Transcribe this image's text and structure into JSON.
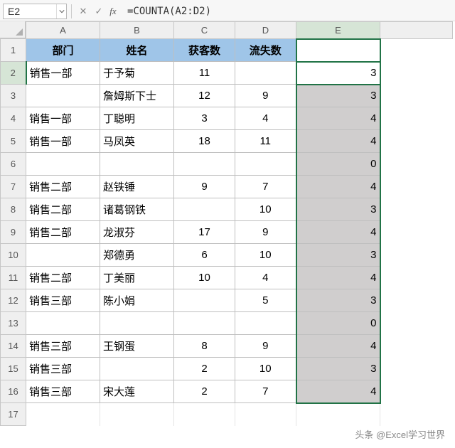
{
  "name_box": "E2",
  "formula": "=COUNTA(A2:D2)",
  "columns": [
    "A",
    "B",
    "C",
    "D",
    "E"
  ],
  "header_row": {
    "A": "部门",
    "B": "姓名",
    "C": "获客数",
    "D": "流失数",
    "E": ""
  },
  "rows": [
    {
      "n": 2,
      "A": "销售一部",
      "B": "于予菊",
      "C": "11",
      "D": "",
      "E": "3"
    },
    {
      "n": 3,
      "A": "",
      "B": "詹姆斯下士",
      "C": "12",
      "D": "9",
      "E": "3"
    },
    {
      "n": 4,
      "A": "销售一部",
      "B": "丁聪明",
      "C": "3",
      "D": "4",
      "E": "4"
    },
    {
      "n": 5,
      "A": "销售一部",
      "B": "马凤英",
      "C": "18",
      "D": "11",
      "E": "4"
    },
    {
      "n": 6,
      "A": "",
      "B": "",
      "C": "",
      "D": "",
      "E": "0"
    },
    {
      "n": 7,
      "A": "销售二部",
      "B": "赵铁锤",
      "C": "9",
      "D": "7",
      "E": "4"
    },
    {
      "n": 8,
      "A": "销售二部",
      "B": "诸葛钢铁",
      "C": "",
      "D": "10",
      "E": "3"
    },
    {
      "n": 9,
      "A": "销售二部",
      "B": "龙淑芬",
      "C": "17",
      "D": "9",
      "E": "4"
    },
    {
      "n": 10,
      "A": "",
      "B": "郑德勇",
      "C": "6",
      "D": "10",
      "E": "3"
    },
    {
      "n": 11,
      "A": "销售二部",
      "B": "丁美丽",
      "C": "10",
      "D": "4",
      "E": "4"
    },
    {
      "n": 12,
      "A": "销售三部",
      "B": "陈小娟",
      "C": "",
      "D": "5",
      "E": "3"
    },
    {
      "n": 13,
      "A": "",
      "B": "",
      "C": "",
      "D": "",
      "E": "0"
    },
    {
      "n": 14,
      "A": "销售三部",
      "B": "王钢蛋",
      "C": "8",
      "D": "9",
      "E": "4"
    },
    {
      "n": 15,
      "A": "销售三部",
      "B": "",
      "C": "2",
      "D": "10",
      "E": "3"
    },
    {
      "n": 16,
      "A": "销售三部",
      "B": "宋大莲",
      "C": "2",
      "D": "7",
      "E": "4"
    }
  ],
  "empty_rows": [
    17
  ],
  "footer": "头条 @Excel学习世界",
  "icons": {
    "cancel": "✕",
    "confirm": "✓"
  }
}
